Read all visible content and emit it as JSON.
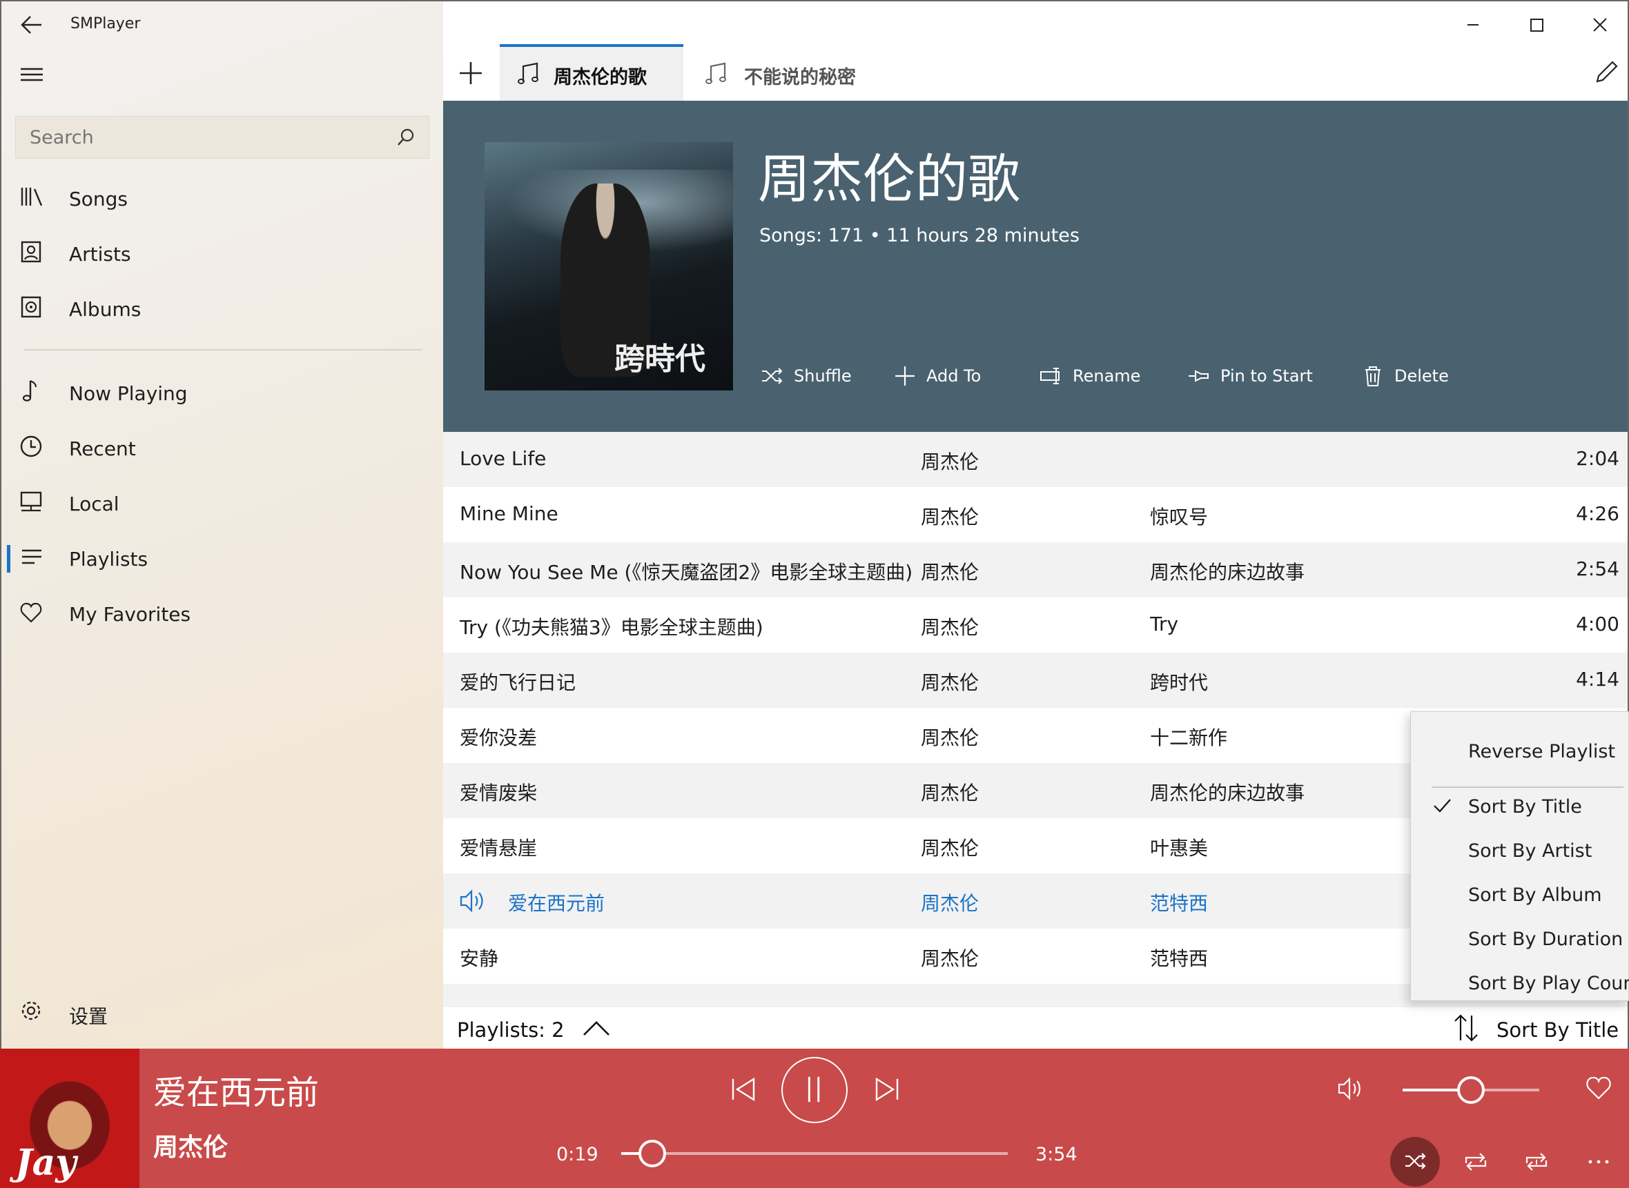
{
  "app": {
    "title": "SMPlayer"
  },
  "sidebar": {
    "search_placeholder": "Search",
    "items": [
      {
        "label": "Songs",
        "icon": "library-icon"
      },
      {
        "label": "Artists",
        "icon": "artist-icon"
      },
      {
        "label": "Albums",
        "icon": "album-icon"
      },
      {
        "label": "Now Playing",
        "icon": "music-note-icon"
      },
      {
        "label": "Recent",
        "icon": "clock-icon"
      },
      {
        "label": "Local",
        "icon": "computer-icon"
      },
      {
        "label": "Playlists",
        "icon": "list-icon",
        "selected": true
      },
      {
        "label": "My Favorites",
        "icon": "heart-icon"
      }
    ],
    "settings_label": "设置"
  },
  "tabs": [
    {
      "label": "周杰伦的歌",
      "active": true
    },
    {
      "label": "不能说的秘密",
      "active": false
    }
  ],
  "playlist": {
    "title": "周杰伦的歌",
    "info": "Songs: 171 • 11 hours 28 minutes",
    "cover_text": "跨時代",
    "actions": [
      "Shuffle",
      "Add To",
      "Rename",
      "Pin to Start",
      "Delete"
    ]
  },
  "songs": [
    {
      "title": "Love Life",
      "artist": "周杰伦",
      "album": "",
      "duration": "2:04"
    },
    {
      "title": "Mine Mine",
      "artist": "周杰伦",
      "album": "惊叹号",
      "duration": "4:26"
    },
    {
      "title": "Now You See Me (《惊天魔盗团2》电影全球主题曲)",
      "artist": "周杰伦",
      "album": "周杰伦的床边故事",
      "duration": "2:54"
    },
    {
      "title": "Try (《功夫熊猫3》电影全球主题曲)",
      "artist": "周杰伦",
      "album": "Try",
      "duration": "4:00"
    },
    {
      "title": "爱的飞行日记",
      "artist": "周杰伦",
      "album": "跨时代",
      "duration": "4:14"
    },
    {
      "title": "爱你没差",
      "artist": "周杰伦",
      "album": "十二新作",
      "duration": ""
    },
    {
      "title": "爱情废柴",
      "artist": "周杰伦",
      "album": "周杰伦的床边故事",
      "duration": ""
    },
    {
      "title": "爱情悬崖",
      "artist": "周杰伦",
      "album": "叶惠美",
      "duration": ""
    },
    {
      "title": "爱在西元前",
      "artist": "周杰伦",
      "album": "范特西",
      "duration": "",
      "playing": true
    },
    {
      "title": "安静",
      "artist": "周杰伦",
      "album": "范特西",
      "duration": ""
    }
  ],
  "footer": {
    "playlists_count": "Playlists: 2",
    "sort_label": "Sort By Title"
  },
  "menu": {
    "items": [
      "Reverse Playlist",
      "Sort By Title",
      "Sort By Artist",
      "Sort By Album",
      "Sort By Duration",
      "Sort By Play Count"
    ],
    "checked": "Sort By Title"
  },
  "player": {
    "title": "爱在西元前",
    "artist": "周杰伦",
    "elapsed": "0:19",
    "total": "3:54",
    "progress": 0.081,
    "volume": 0.5,
    "cover_text": "Jay",
    "colors": {
      "background": "#c94a4a",
      "banner": "#4a6270",
      "accent": "#1a73c8"
    }
  }
}
